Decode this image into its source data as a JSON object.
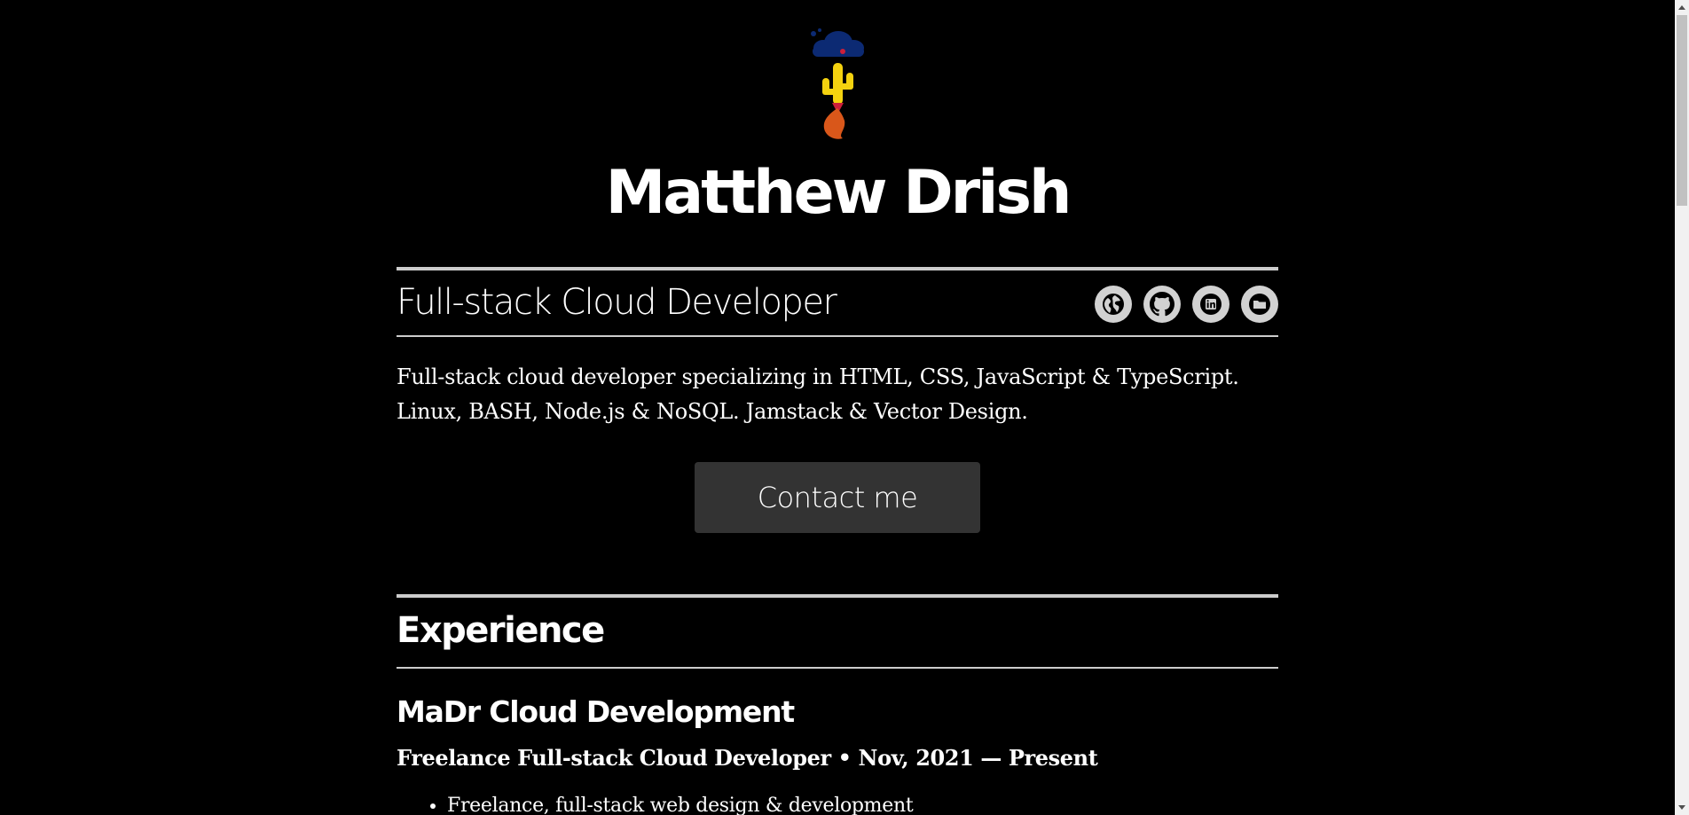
{
  "header": {
    "name": "Matthew Drish",
    "subtitle": "Full-stack Cloud Developer"
  },
  "social": [
    {
      "name": "website",
      "icon": "globe-icon"
    },
    {
      "name": "github",
      "icon": "github-icon"
    },
    {
      "name": "linkedin",
      "icon": "linkedin-icon"
    },
    {
      "name": "portfolio",
      "icon": "folder-icon"
    }
  ],
  "summary": {
    "line1": "Full-stack cloud developer specializing in HTML, CSS, JavaScript & TypeScript.",
    "line2": "Linux, BASH, Node.js & NoSQL. Jamstack & Vector Design."
  },
  "contact_label": "Contact me",
  "experience": {
    "title": "Experience",
    "items": [
      {
        "company": "MaDr Cloud Development",
        "role": "Freelance Full-stack Cloud Developer • Nov, 2021 — Present",
        "bullets": [
          "Freelance, full-stack web design & development"
        ]
      }
    ]
  },
  "colors": {
    "background": "#000000",
    "text": "#ffffff",
    "rule": "#cccccc",
    "button": "#333333",
    "icon_bg": "#d2d2d2",
    "logo_cloud": "#0c2a73",
    "logo_cactus": "#f4d20f",
    "logo_flame": "#d9571a",
    "logo_accent": "#cc1f3a"
  }
}
